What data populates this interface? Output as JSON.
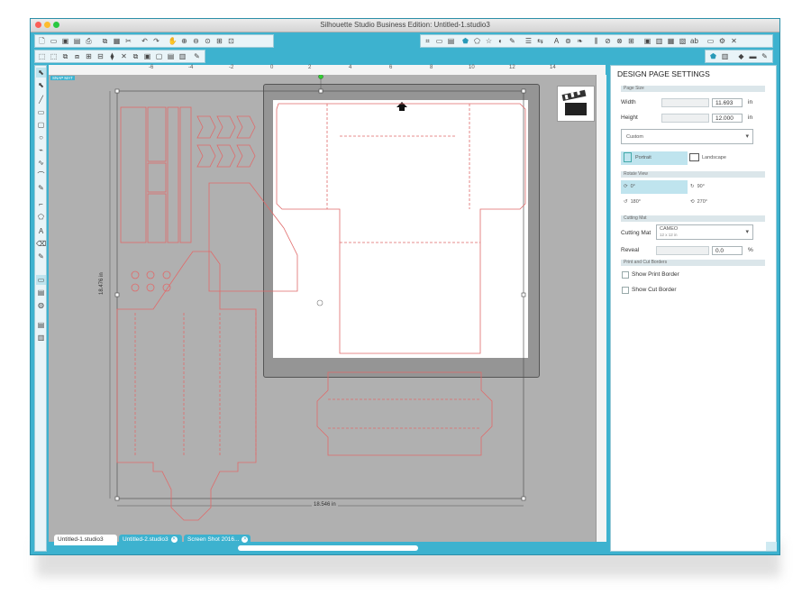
{
  "window": {
    "title": "Silhouette Studio Business Edition: Untitled-1.studio3"
  },
  "colors": {
    "accent": "#3db2cf",
    "cut_line": "#e06a6a",
    "panel_section": "#dbe6ea"
  },
  "canvas": {
    "snap_label": "SNAP MAT",
    "ruler_labels": [
      "-6",
      "-4",
      "-2",
      "0",
      "2",
      "4",
      "6",
      "8",
      "10",
      "12",
      "14"
    ],
    "width_dimension": "18.546 in",
    "height_dimension": "18.476 in"
  },
  "panel": {
    "title": "DESIGN PAGE SETTINGS",
    "page_size": {
      "section": "Page Size",
      "width_label": "Width",
      "width_value": "11.693",
      "width_unit": "in",
      "height_label": "Height",
      "height_value": "12.000",
      "height_unit": "in",
      "size_preset": "Custom",
      "portrait_label": "Portrait",
      "landscape_label": "Landscape"
    },
    "rotate_view": {
      "section": "Rotate View",
      "options": [
        "0°",
        "90°",
        "180°",
        "270°"
      ]
    },
    "cutting_mat": {
      "section": "Cutting Mat",
      "label": "Cutting Mat",
      "value": "CAMEO",
      "sub_value": "12 x 12 in",
      "reveal_label": "Reveal",
      "reveal_value": "0.0",
      "reveal_unit": "%"
    },
    "borders": {
      "section": "Print and Cut Borders",
      "show_print_border": "Show Print Border",
      "show_cut_border": "Show Cut Border"
    }
  },
  "tabs": [
    {
      "label": "Untitled-1.studio3"
    },
    {
      "label": "Untitled-2.studio3"
    },
    {
      "label": "Screen Shot 2016..."
    }
  ],
  "icons": {
    "rotate_90": "↻",
    "rotate_180": "↺",
    "rotate_270": "⟲"
  }
}
